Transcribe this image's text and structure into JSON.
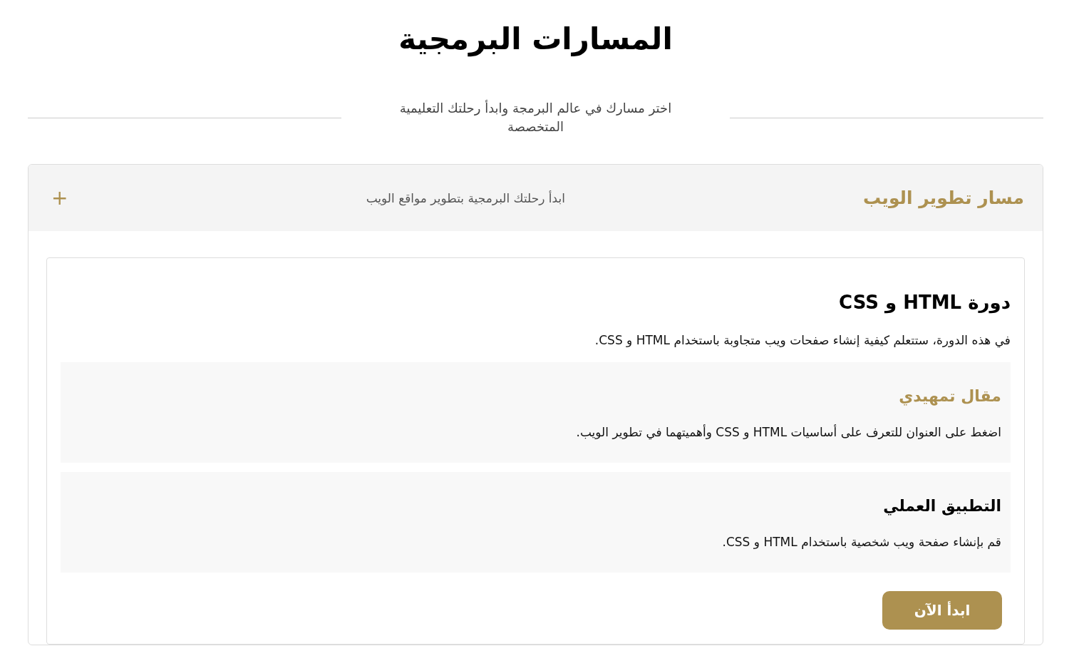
{
  "page": {
    "title": "المسارات البرمجية",
    "subtitle": "اختر مسارك في عالم البرمجة وابدأ رحلتك التعليمية المتخصصة"
  },
  "tracks": [
    {
      "title": "مسار تطوير الويب",
      "description": "ابدأ رحلتك البرمجية بتطوير مواقع الويب",
      "toggle": "+",
      "expanded": true,
      "courses": [
        {
          "title": "دورة HTML و CSS",
          "description": "في هذه الدورة، ستتعلم كيفية إنشاء صفحات ويب متجاوبة باستخدام HTML و CSS.",
          "lessons": [
            {
              "kind": "article",
              "title": "مقال تمهيدي",
              "description": "اضغط على العنوان للتعرف على أساسيات HTML و CSS وأهميتهما في تطوير الويب."
            },
            {
              "kind": "task",
              "title": "التطبيق العملي",
              "description": "قم بإنشاء صفحة ويب شخصية باستخدام HTML و CSS."
            }
          ],
          "button": "ابدأ الآن"
        }
      ]
    }
  ]
}
